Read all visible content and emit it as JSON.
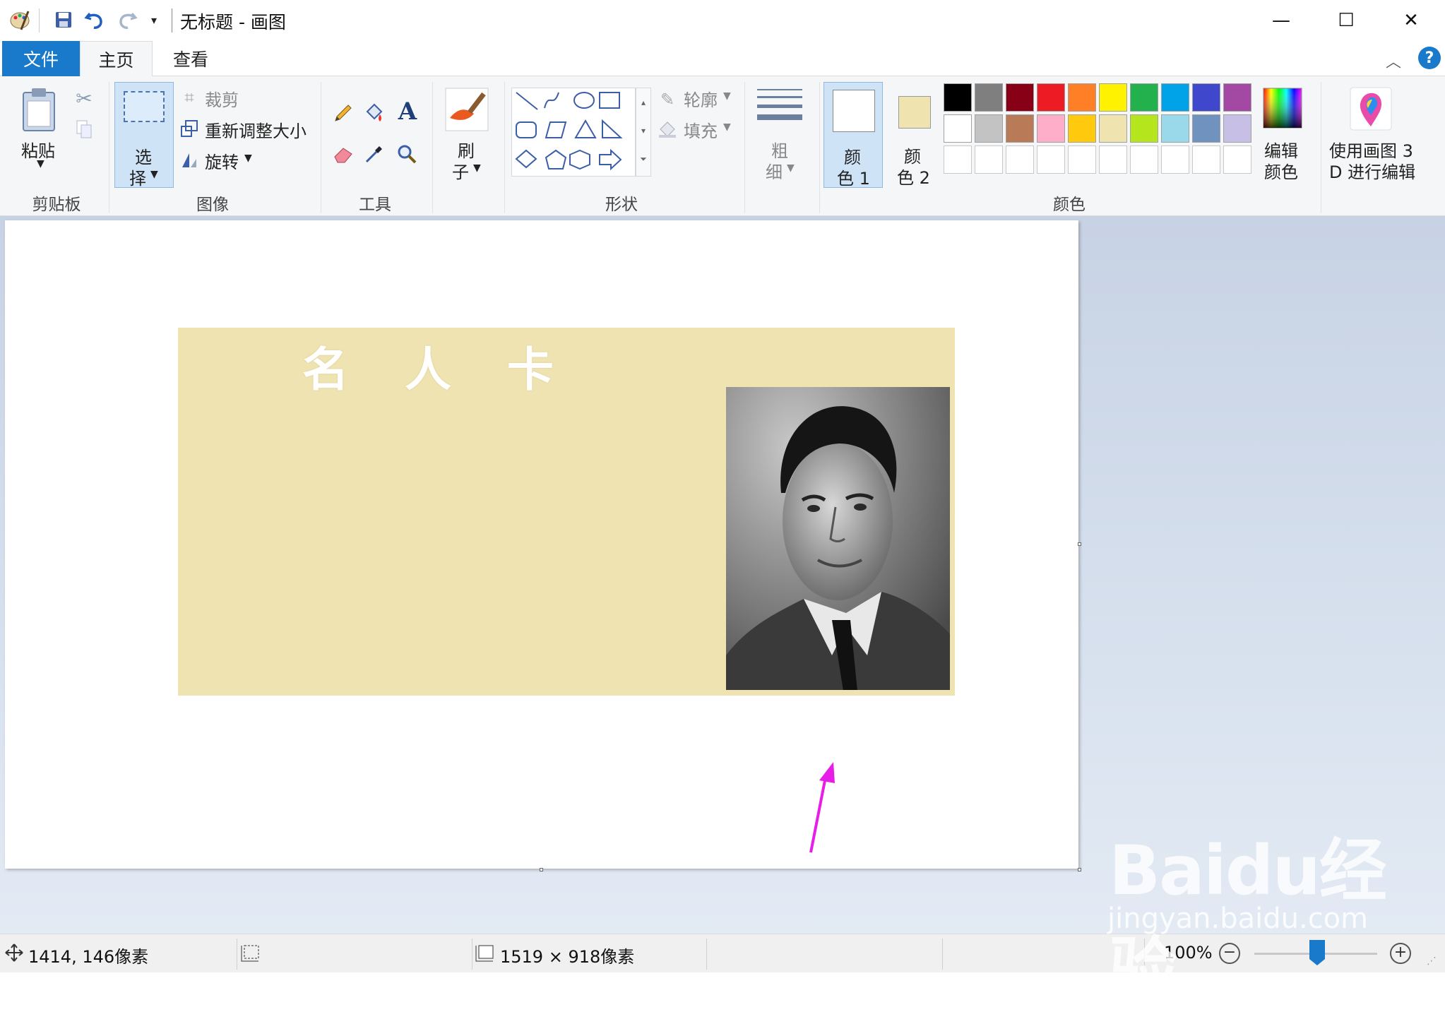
{
  "window": {
    "title": "无标题 - 画图",
    "minimize": "—",
    "maximize": "☐",
    "close": "✕"
  },
  "tabs": {
    "file": "文件",
    "home": "主页",
    "view": "查看"
  },
  "ribbon": {
    "clipboard": {
      "group": "剪贴板",
      "paste": "粘贴"
    },
    "image": {
      "group": "图像",
      "select_line1": "选",
      "select_line2": "择",
      "crop": "裁剪",
      "resize": "重新调整大小",
      "rotate": "旋转"
    },
    "tools": {
      "group": "工具"
    },
    "brushes": {
      "line1": "刷",
      "line2": "子"
    },
    "shapes": {
      "group": "形状",
      "outline": "轮廓",
      "fill": "填充"
    },
    "size": {
      "line1": "粗",
      "line2": "细"
    },
    "colors": {
      "group": "颜色",
      "color1_line1": "颜",
      "color1_line2": "色 1",
      "color2_line1": "颜",
      "color2_line2": "色 2",
      "edit_line1": "编辑",
      "edit_line2": "颜色",
      "paint3d_line1": "使用画图 3",
      "paint3d_line2": "D 进行编辑",
      "color1": "#ffffff",
      "color2": "#efe4b0",
      "palette_row1": [
        "#000000",
        "#7f7f7f",
        "#880015",
        "#ed1c24",
        "#ff7f27",
        "#fff200",
        "#22b14c",
        "#00a2e8",
        "#3f48cc",
        "#a349a4"
      ],
      "palette_row2": [
        "#ffffff",
        "#c3c3c3",
        "#b97a57",
        "#ffaec9",
        "#ffc90e",
        "#efe4b0",
        "#b5e61d",
        "#99d9ea",
        "#7092be",
        "#c8bfe7"
      ]
    }
  },
  "canvas": {
    "card_title": "名 人 卡",
    "card_color": "#eee3b1",
    "arrow_color": "#e81ee8"
  },
  "status": {
    "cursor_pos": "1414, 146像素",
    "image_size": "1519 × 918像素",
    "zoom": "100%"
  },
  "watermark": {
    "brand": "Baidu经验",
    "url": "jingyan.baidu.com"
  }
}
